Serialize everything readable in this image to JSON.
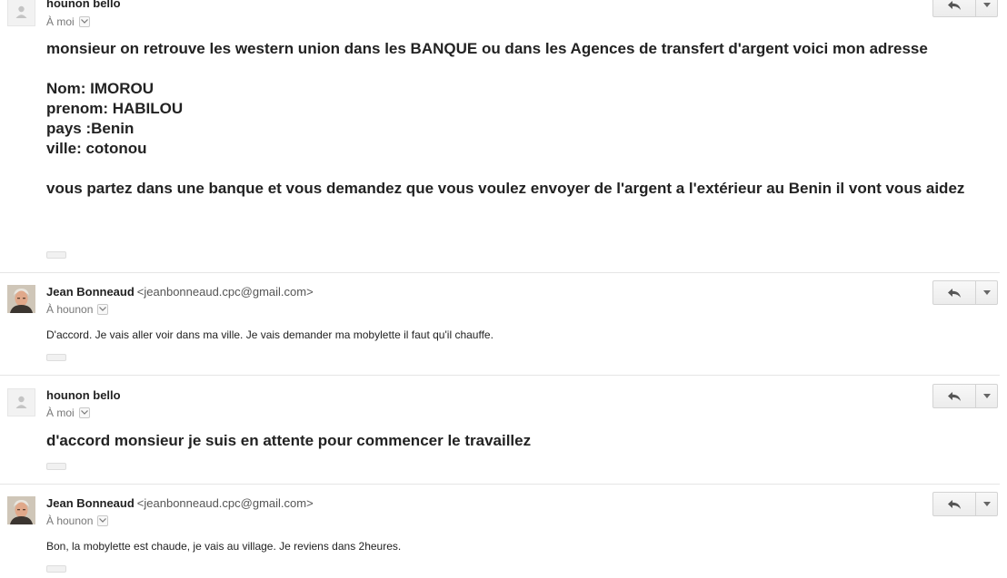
{
  "messages": [
    {
      "sender_name": "hounon bello",
      "sender_email": "",
      "recipient": "À moi",
      "avatar": "person-placeholder-icon",
      "style": "large-bold",
      "body_lines": [
        "monsieur on retrouve les western union dans les BANQUE ou dans les Agences de transfert d'argent voici mon adresse",
        "",
        "Nom: IMOROU",
        "prenom: HABILOU",
        "pays :Benin",
        "ville: cotonou",
        "",
        "vous partez dans une banque et vous demandez que vous voulez envoyer de l'argent a l'extérieur au Benin il vont vous aidez"
      ]
    },
    {
      "sender_name": "Jean Bonneaud",
      "sender_email": "<jeanbonneaud.cpc@gmail.com>",
      "recipient": "À hounon",
      "avatar": "user-photo",
      "style": "normal",
      "body_lines": [
        "D'accord. Je vais aller voir dans ma ville. Je vais demander ma mobylette il faut qu'il chauffe."
      ]
    },
    {
      "sender_name": "hounon bello",
      "sender_email": "",
      "recipient": "À moi",
      "avatar": "person-placeholder-icon",
      "style": "large-bold",
      "body_lines": [
        "d'accord monsieur je suis en attente pour commencer le travaillez"
      ]
    },
    {
      "sender_name": "Jean Bonneaud",
      "sender_email": "<jeanbonneaud.cpc@gmail.com>",
      "recipient": "À hounon",
      "avatar": "user-photo",
      "style": "normal",
      "body_lines": [
        "Bon, la mobylette est chaude, je vais au village. Je reviens dans 2heures."
      ]
    }
  ],
  "icons": {
    "reply": "reply-icon",
    "more": "chevron-down-icon",
    "recipient_details": "caret-down-icon"
  },
  "colors": {
    "text": "#222222",
    "muted": "#777777",
    "divider": "#e5e5e5",
    "button_border": "#d3d3d3"
  }
}
